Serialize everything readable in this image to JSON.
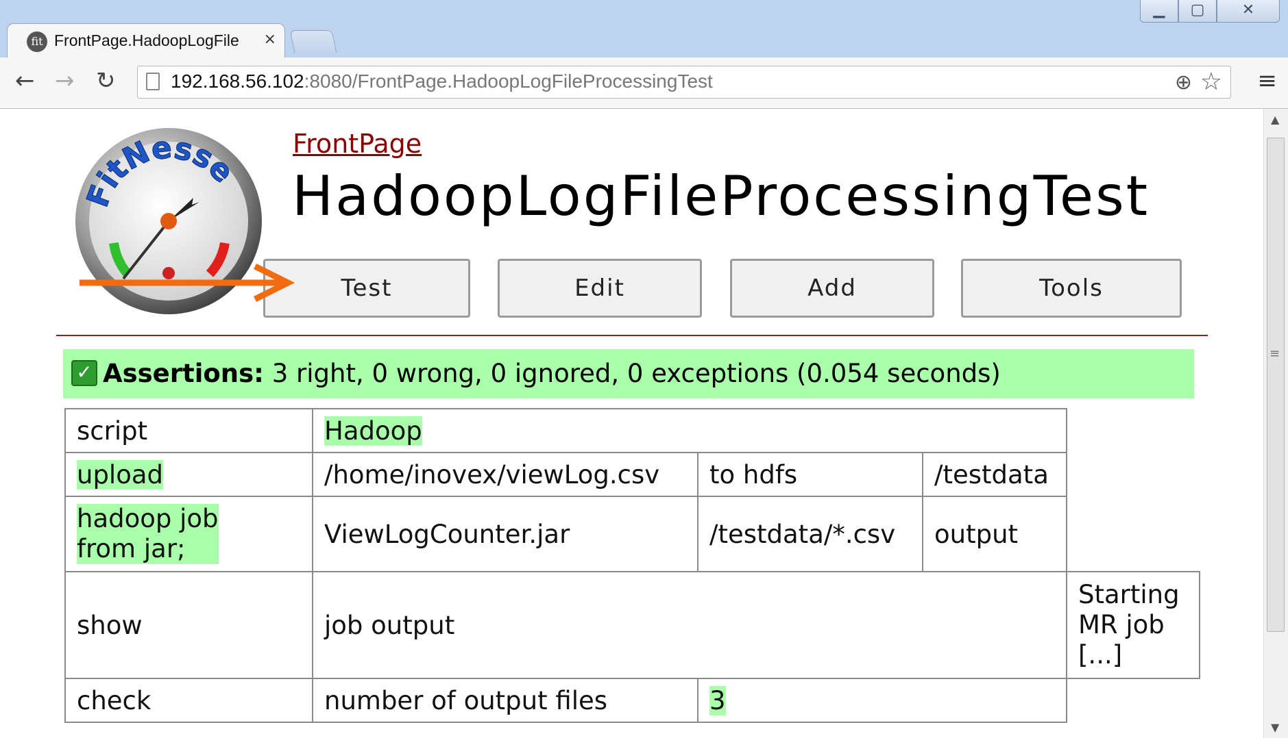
{
  "window": {
    "controls": {
      "minimize": "▁",
      "maximize": "▢",
      "close": "✕"
    }
  },
  "tab": {
    "favicon": "fit",
    "title": "FrontPage.HadoopLogFile",
    "close": "×"
  },
  "toolbar": {
    "back": "←",
    "forward": "→",
    "reload": "↻",
    "url_host": "192.168.56.102",
    "url_rest": ":8080/FrontPage.HadoopLogFileProcessingTest",
    "zoom_icon": "⊕",
    "star_icon": "☆",
    "menu_icon": "≡"
  },
  "page": {
    "logo_text": "FitNesse",
    "breadcrumb": "FrontPage",
    "title": "HadoopLogFileProcessingTest",
    "buttons": {
      "test": "Test",
      "edit": "Edit",
      "add": "Add",
      "tools": "Tools"
    }
  },
  "summary": {
    "label": "Assertions:",
    "text": " 3 right, 0 wrong, 0 ignored, 0 exceptions (0.054 seconds)"
  },
  "table": {
    "r0": {
      "c0": "script",
      "c1": "Hadoop"
    },
    "r1": {
      "c0": "upload",
      "c1": "/home/inovex/viewLog.csv",
      "c2": "to hdfs",
      "c3": "/testdata"
    },
    "r2": {
      "c0a": "hadoop job",
      "c0b": "from jar;",
      "c1": "ViewLogCounter.jar",
      "c2": "/testdata/*.csv",
      "c3": "output"
    },
    "r3": {
      "c0": "show",
      "c1": "job output",
      "c4a": "Starting",
      "c4b": "MR job",
      "c4c": "[...]"
    },
    "r4": {
      "c0": "check",
      "c1": "number of output files",
      "c2": "3"
    }
  },
  "colors": {
    "pass": "#aaffaa",
    "link": "#8b0000",
    "divider": "#9b1b1b",
    "annotation_arrow": "#f26b10"
  }
}
